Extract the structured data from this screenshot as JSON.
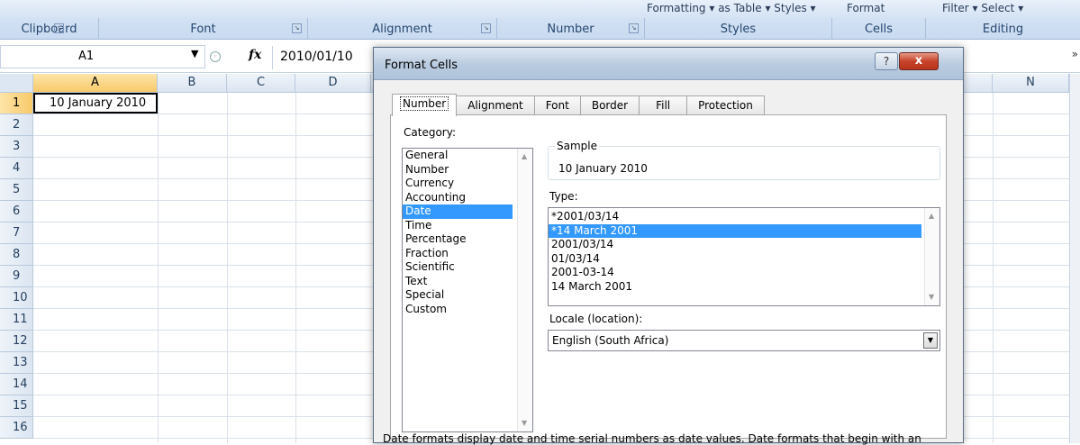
{
  "ribbon": {
    "top_fragments": {
      "format_table_styles": "Formatting ▾ as Table ▾ Styles ▾",
      "format": "Format",
      "filter_select": "Filter ▾ Select ▾"
    },
    "groups": [
      "Clipboard",
      "Font",
      "Alignment",
      "Number",
      "Styles",
      "Cells",
      "Editing"
    ]
  },
  "formula_bar": {
    "name_box": "A1",
    "fx": "fx",
    "value": "2010/01/10"
  },
  "grid": {
    "columns_visible": [
      "A",
      "B",
      "C",
      "D",
      "N"
    ],
    "rows": [
      "1",
      "2",
      "3",
      "4",
      "5",
      "6",
      "7",
      "8",
      "9",
      "10",
      "11",
      "12",
      "13",
      "14",
      "15",
      "16"
    ],
    "cell_a1": "10 January 2010"
  },
  "dialog": {
    "title": "Format Cells",
    "help": "?",
    "close": "x",
    "tabs": [
      "Number",
      "Alignment",
      "Font",
      "Border",
      "Fill",
      "Protection"
    ],
    "active_tab": "Number",
    "category_label": "Category:",
    "categories": [
      "General",
      "Number",
      "Currency",
      "Accounting",
      "Date",
      "Time",
      "Percentage",
      "Fraction",
      "Scientific",
      "Text",
      "Special",
      "Custom"
    ],
    "selected_category": "Date",
    "sample_label": "Sample",
    "sample_value": "10 January 2010",
    "type_label": "Type:",
    "types": [
      "*2001/03/14",
      "*14 March 2001",
      "2001/03/14",
      "01/03/14",
      "2001-03-14",
      "14 March 2001"
    ],
    "selected_type": "*14 March 2001",
    "locale_label": "Locale (location):",
    "locale_value": "English (South Africa)",
    "description": "Date formats display date and time serial numbers as date values.  Date formats that begin with an"
  }
}
